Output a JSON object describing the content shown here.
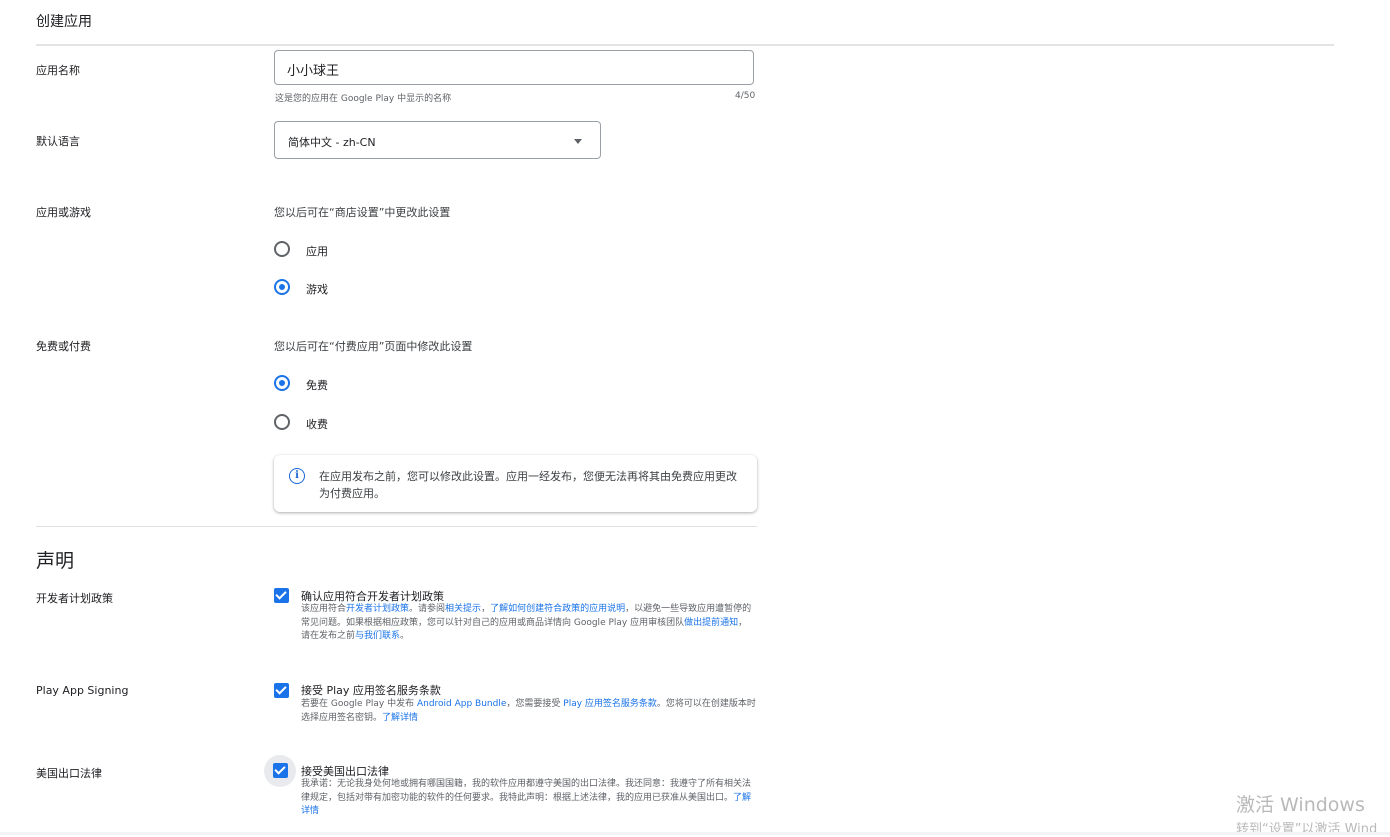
{
  "page": {
    "title": "创建应用"
  },
  "app_name": {
    "label": "应用名称",
    "value": "小小球王",
    "helper": "这是您的应用在 Google Play 中显示的名称",
    "counter": "4/50"
  },
  "default_language": {
    "label": "默认语言",
    "selected": "简体中文 - zh-CN",
    "caret_icon": "arrow-drop-down-icon"
  },
  "app_or_game": {
    "label": "应用或游戏",
    "hint": "您以后可在“商店设置”中更改此设置",
    "options": [
      {
        "label": "应用",
        "selected": false
      },
      {
        "label": "游戏",
        "selected": true
      }
    ]
  },
  "free_or_paid": {
    "label": "免费或付费",
    "hint": "您以后可在“付费应用”页面中修改此设置",
    "options": [
      {
        "label": "免费",
        "selected": true
      },
      {
        "label": "收费",
        "selected": false
      }
    ],
    "info_icon": "info-icon",
    "info_text": "在应用发布之前，您可以修改此设置。应用一经发布，您便无法再将其由免费应用更改为付费应用。"
  },
  "declarations": {
    "title": "声明",
    "developer_policy": {
      "label": "开发者计划政策",
      "checked": true,
      "title": "确认应用符合开发者计划政策",
      "desc_parts": {
        "t1": "该应用符合",
        "l1": "开发者计划政策",
        "t2": "。请参阅",
        "l2": "相关提示",
        "t3": "，",
        "l3": "了解如何创建符合政策的应用说明",
        "t4": "，以避免一些导致应用遭暂停的常见问题。如果根据相应政策，您可以针对自己的应用或商品详情向 Google Play 应用审核团队",
        "l4": "做出提前通知",
        "t5": "，请在发布之前",
        "l5": "与我们联系",
        "t6": "。"
      }
    },
    "play_app_signing": {
      "label": "Play App Signing",
      "checked": true,
      "title": "接受 Play 应用签名服务条款",
      "desc_parts": {
        "t1": "若要在 Google Play 中发布 ",
        "l1": "Android App Bundle",
        "t2": "，您需要接受 ",
        "l2": "Play 应用签名服务条款",
        "t3": "。您将可以在创建版本时选择应用签名密钥。",
        "l3": "了解详情"
      }
    },
    "us_export": {
      "label": "美国出口法律",
      "checked": true,
      "title": "接受美国出口法律",
      "desc_parts": {
        "t1": "我承诺：无论我身处何地或拥有哪国国籍，我的软件应用都遵守美国的出口法律。我还同意：我遵守了所有相关法律规定，包括对带有加密功能的软件的任何要求。我特此声明：根据上述法律，我的应用已获准从美国出口。",
        "l1": "了解详情"
      }
    }
  },
  "watermark": {
    "line1": "激活 Windows",
    "line2": "转到“设置”以激活 Wind"
  }
}
